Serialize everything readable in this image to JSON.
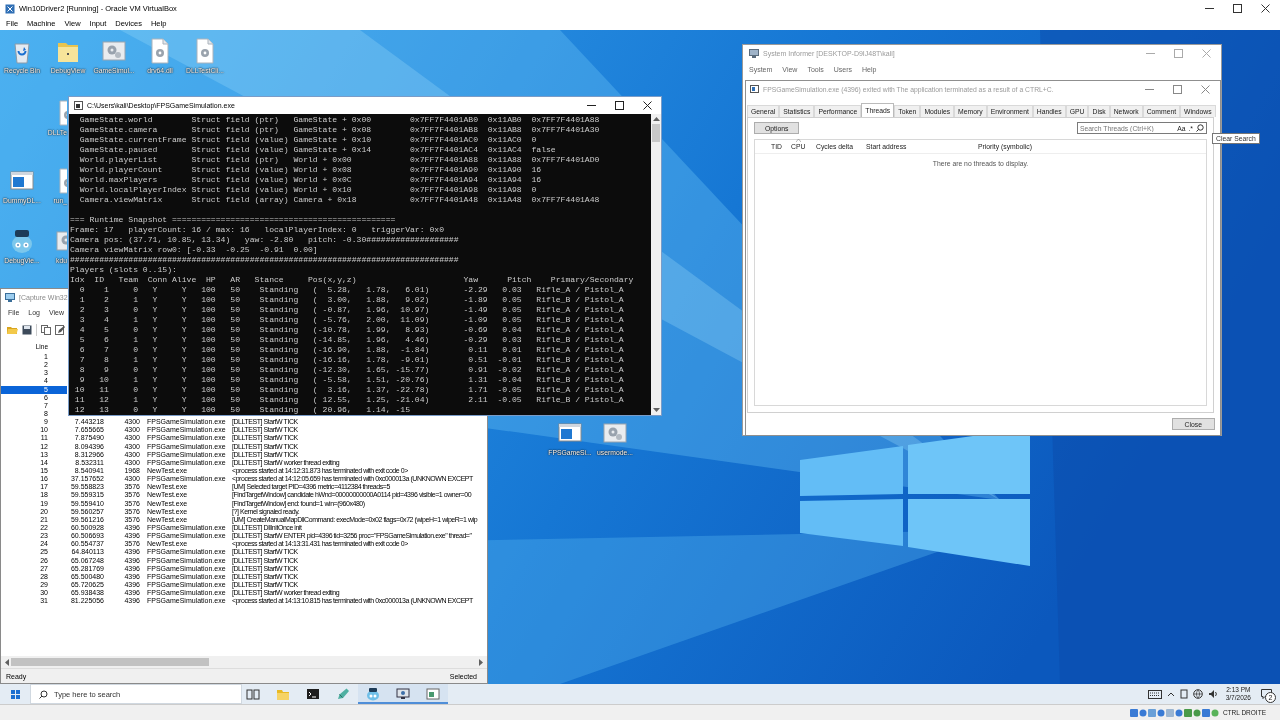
{
  "host_window": {
    "title": "Win10Driver2 [Running] - Oracle VM VirtualBox",
    "menu": [
      "File",
      "Machine",
      "View",
      "Input",
      "Devices",
      "Help"
    ]
  },
  "desktop_icons": [
    {
      "label": "Recycle Bin",
      "kind": "recycle"
    },
    {
      "label": "DebugView",
      "kind": "folder"
    },
    {
      "label": "GameSimul...",
      "kind": "app"
    },
    {
      "label": "drv64.dll",
      "kind": "file"
    },
    {
      "label": "DLLTestCli...",
      "kind": "file"
    },
    {
      "label": "DLLTe",
      "kind": "file"
    },
    {
      "label": "DummyDL...",
      "kind": "window"
    },
    {
      "label": "run_",
      "kind": "file"
    },
    {
      "label": "DebugVie...",
      "kind": "bug"
    },
    {
      "label": "kdu",
      "kind": "app"
    },
    {
      "label": "FPSGameSi...",
      "kind": "window"
    },
    {
      "label": "usermode...",
      "kind": "app"
    }
  ],
  "debugview": {
    "title": "[Capture Win32",
    "menu": [
      "File",
      "Log",
      "View"
    ],
    "columns": [
      "Line"
    ],
    "rows": [
      {
        "line": "1",
        "selected": false
      },
      {
        "line": "2",
        "selected": false
      },
      {
        "line": "3",
        "selected": false
      },
      {
        "line": "4",
        "selected": false
      },
      {
        "line": "5",
        "selected": true
      },
      {
        "line": "6",
        "selected": false
      },
      {
        "line": "7",
        "selected": false
      },
      {
        "line": "8",
        "selected": false
      },
      {
        "line": "9",
        "column_2": "7.443218",
        "column_3": "4300",
        "column_4": "FPSGameSimulation.exe",
        "column_5": "[DLLTEST] StartW TICK",
        "selected": false
      },
      {
        "line": "10",
        "column_2": "7.655665",
        "column_3": "4300",
        "column_4": "FPSGameSimulation.exe",
        "column_5": "[DLLTEST] StartW TICK",
        "selected": false
      },
      {
        "line": "11",
        "column_2": "7.875490",
        "column_3": "4300",
        "column_4": "FPSGameSimulation.exe",
        "column_5": "[DLLTEST] StartW TICK",
        "selected": false
      },
      {
        "line": "12",
        "column_2": "8.094396",
        "column_3": "4300",
        "column_4": "FPSGameSimulation.exe",
        "column_5": "[DLLTEST] StartW TICK",
        "selected": false
      },
      {
        "line": "13",
        "column_2": "8.312966",
        "column_3": "4300",
        "column_4": "FPSGameSimulation.exe",
        "column_5": "[DLLTEST] StartW TICK",
        "selected": false
      },
      {
        "line": "14",
        "column_2": "8.532311",
        "column_3": "4300",
        "column_4": "FPSGameSimulation.exe",
        "column_5": "[DLLTEST] StartW worker thread exiting",
        "selected": false
      },
      {
        "line": "15",
        "column_2": "8.540941",
        "column_3": "1968",
        "column_4": "NewTest.exe",
        "column_5": "<process started at 14:12:31.873 has terminated with exit code 0>",
        "selected": false
      },
      {
        "line": "16",
        "column_2": "37.157652",
        "column_3": "4300",
        "column_4": "FPSGameSimulation.exe",
        "column_5": "<process started at 14:12:05.659 has terminated with 0xc000013a (UNKNOWN EXCEPT",
        "selected": false
      },
      {
        "line": "17",
        "column_2": "59.558823",
        "column_3": "3576",
        "column_4": "NewTest.exe",
        "column_5": "[UM] Selected target PID=4396 metric=4112384 threads=5",
        "selected": false
      },
      {
        "line": "18",
        "column_2": "59.559315",
        "column_3": "3576",
        "column_4": "NewTest.exe",
        "column_5": "[FindTargetWindow] candidate hWnd=00000000000A0114 pid=4396 visible=1 owner=00",
        "selected": false
      },
      {
        "line": "19",
        "column_2": "59.559410",
        "column_3": "3576",
        "column_4": "NewTest.exe",
        "column_5": "[FindTargetWindow] end: found=1 win=(960x480)",
        "selected": false
      },
      {
        "line": "20",
        "column_2": "59.560257",
        "column_3": "3576",
        "column_4": "NewTest.exe",
        "column_5": "[?] Kernel signaled ready.",
        "selected": false
      },
      {
        "line": "21",
        "column_2": "59.561216",
        "column_3": "3576",
        "column_4": "NewTest.exe",
        "column_5": "[UM] CreateManualMapDllCommand: execMode=0x02 flags=0x72 (wipeH=1 wipeR=1 wip",
        "selected": false
      },
      {
        "line": "22",
        "column_2": "60.500928",
        "column_3": "4396",
        "column_4": "FPSGameSimulation.exe",
        "column_5": "[DLLTEST] DllInitOnce init",
        "selected": false
      },
      {
        "line": "23",
        "column_2": "60.506693",
        "column_3": "4396",
        "column_4": "FPSGameSimulation.exe",
        "column_5": "[DLLTEST] StartW ENTER pid=4396 tid=3256 proc=\"FPSGameSimulation.exe\" thread=\"",
        "selected": false
      },
      {
        "line": "24",
        "column_2": "60.554737",
        "column_3": "3576",
        "column_4": "NewTest.exe",
        "column_5": "<process started at 14:13:31.431 has terminated with exit code 0>",
        "selected": false
      },
      {
        "line": "25",
        "column_2": "64.840113",
        "column_3": "4396",
        "column_4": "FPSGameSimulation.exe",
        "column_5": "[DLLTEST] StartW TICK",
        "selected": false
      },
      {
        "line": "26",
        "column_2": "65.067248",
        "column_3": "4396",
        "column_4": "FPSGameSimulation.exe",
        "column_5": "[DLLTEST] StartW TICK",
        "selected": false
      },
      {
        "line": "27",
        "column_2": "65.281769",
        "column_3": "4396",
        "column_4": "FPSGameSimulation.exe",
        "column_5": "[DLLTEST] StartW TICK",
        "selected": false
      },
      {
        "line": "28",
        "column_2": "65.500480",
        "column_3": "4396",
        "column_4": "FPSGameSimulation.exe",
        "column_5": "[DLLTEST] StartW TICK",
        "selected": false
      },
      {
        "line": "29",
        "column_2": "65.720625",
        "column_3": "4396",
        "column_4": "FPSGameSimulation.exe",
        "column_5": "[DLLTEST] StartW TICK",
        "selected": false
      },
      {
        "line": "30",
        "column_2": "65.938438",
        "column_3": "4396",
        "column_4": "FPSGameSimulation.exe",
        "column_5": "[DLLTEST] StartW worker thread exiting",
        "selected": false
      },
      {
        "line": "31",
        "column_2": "81.225056",
        "column_3": "4396",
        "column_4": "FPSGameSimulation.exe",
        "column_5": "<process started at 14:13:10.815 has terminated with 0xc000013a (UNKNOWN EXCEPT",
        "selected": false
      }
    ],
    "status": "Ready",
    "status_right": "Selected"
  },
  "console": {
    "title": "C:\\Users\\kali\\Desktop\\FPSGameSimulation.exe",
    "field_lines": [
      "  GameState.world        Struct field (ptr)   GameState + 0x00        0x7FF7F4401AB0  0x11AB0  0x7FF7F4401A88",
      "  GameState.camera       Struct field (ptr)   GameState + 0x08        0x7FF7F4401AB8  0x11AB8  0x7FF7F4401A30",
      "  GameState.currentFrame Struct field (value) GameState + 0x10        0x7FF7F4401AC0  0x11AC0  0",
      "  GameState.paused       Struct field (value) GameState + 0x14        0x7FF7F4401AC4  0x11AC4  false",
      "  World.playerList       Struct field (ptr)   World + 0x00            0x7FF7F4401A88  0x11A88  0x7FF7F4401AD0",
      "  World.playerCount      Struct field (value) World + 0x08            0x7FF7F4401A90  0x11A90  16",
      "  World.maxPlayers       Struct field (value) World + 0x0C            0x7FF7F4401A94  0x11A94  16",
      "  World.localPlayerIndex Struct field (value) World + 0x10            0x7FF7F4401A98  0x11A98  0",
      "  Camera.viewMatrix      Struct field (array) Camera + 0x18           0x7FF7F4401A48  0x11A48  0x7FF7F4401A48"
    ],
    "snapshot_lines": [
      "=== Runtime Snapshot ==============================================",
      "Frame: 17   playerCount: 16 / max: 16   localPlayerIndex: 0   triggerVar: 0x0",
      "Camera pos: (37.71, 10.85, 13.34)   yaw: -2.80   pitch: -0.30###################",
      "Camera viewMatrix row0: [-0.33  -0.25  -0.91  0.00]",
      "################################################################################",
      "Players (slots 0..15):"
    ],
    "table_header": "Idx  ID   Team  Conn Alive  HP   AR   Stance     Pos(x,y,z)                      Yaw      Pitch    Primary/Secondary",
    "table_rows": [
      "  0    1     0   Y     Y   100   50    Standing   (  5.28,   1.78,   6.01)       -2.29   0.03   Rifle_A / Pistol_A",
      "  1    2     1   Y     Y   100   50    Standing   (  3.00,   1.88,   9.02)       -1.89   0.05   Rifle_B / Pistol_A",
      "  2    3     0   Y     Y   100   50    Standing   ( -0.87,   1.96,  10.97)       -1.49   0.05   Rifle_A / Pistol_A",
      "  3    4     1   Y     Y   100   50    Standing   ( -5.76,   2.00,  11.09)       -1.09   0.05   Rifle_B / Pistol_A",
      "  4    5     0   Y     Y   100   50    Standing   (-10.78,   1.99,   8.93)       -0.69   0.04   Rifle_A / Pistol_A",
      "  5    6     1   Y     Y   100   50    Standing   (-14.85,   1.96,   4.46)       -0.29   0.03   Rifle_B / Pistol_A",
      "  6    7     0   Y     Y   100   50    Standing   (-16.90,   1.88,  -1.84)        0.11   0.01   Rifle_A / Pistol_A",
      "  7    8     1   Y     Y   100   50    Standing   (-16.16,   1.78,  -9.01)        0.51  -0.01   Rifle_B / Pistol_A",
      "  8    9     0   Y     Y   100   50    Standing   (-12.30,   1.65, -15.77)        0.91  -0.02   Rifle_A / Pistol_A",
      "  9   10     1   Y     Y   100   50    Standing   ( -5.58,   1.51, -20.76)        1.31  -0.04   Rifle_B / Pistol_A",
      " 10   11     0   Y     Y   100   50    Standing   (  3.16,   1.37, -22.78)        1.71  -0.05   Rifle_A / Pistol_A",
      " 11   12     1   Y     Y   100   50    Standing   ( 12.55,   1.25, -21.04)        2.11  -0.05   Rifle_B / Pistol_A",
      " 12   13     0   Y     Y   100   50    Standing   ( 20.96,   1.14, -15"
    ]
  },
  "system_informer": {
    "title": "System Informer [DESKTOP-D9IJ48T\\kali]",
    "menu": [
      "System",
      "View",
      "Tools",
      "Users",
      "Help"
    ]
  },
  "process_window": {
    "title": "FPSGameSimulation.exe (4396) exited with The application terminated as a result of a CTRL+C.",
    "tabs": [
      {
        "label": "General",
        "selected": false
      },
      {
        "label": "Statistics",
        "selected": false
      },
      {
        "label": "Performance",
        "selected": false
      },
      {
        "label": "Threads",
        "selected": true
      },
      {
        "label": "Token",
        "selected": false
      },
      {
        "label": "Modules",
        "selected": false
      },
      {
        "label": "Memory",
        "selected": false
      },
      {
        "label": "Environment",
        "selected": false
      },
      {
        "label": "Handles",
        "selected": false
      },
      {
        "label": "GPU",
        "selected": false
      },
      {
        "label": "Disk",
        "selected": false
      },
      {
        "label": "Network",
        "selected": false
      },
      {
        "label": "Comment",
        "selected": false
      },
      {
        "label": "Windows",
        "selected": false
      }
    ],
    "options_button": "Options",
    "search": {
      "placeholder": "Search Threads (Ctrl+K)",
      "case_toggle": "Aa",
      "regex_toggle": ".*"
    },
    "columns": [
      "TID",
      "CPU",
      "Cycles delta",
      "Start address",
      "Priority (symbolic)"
    ],
    "empty_message": "There are no threads to display.",
    "close_button": "Close",
    "tooltip": "Clear Search"
  },
  "taskbar": {
    "search_placeholder": "Type here to search",
    "apps": [
      {
        "kind": "task-view",
        "active": false
      },
      {
        "kind": "folder",
        "active": false
      },
      {
        "kind": "terminal",
        "active": false
      },
      {
        "kind": "tool",
        "active": false
      },
      {
        "kind": "bug",
        "active": true
      },
      {
        "kind": "monitor",
        "active": true
      },
      {
        "kind": "console",
        "active": true
      }
    ],
    "time": "2:13 PM",
    "date": "3/7/2026",
    "notification_count": "2"
  },
  "host_status": {
    "host_key": "CTRL DROITE"
  }
}
